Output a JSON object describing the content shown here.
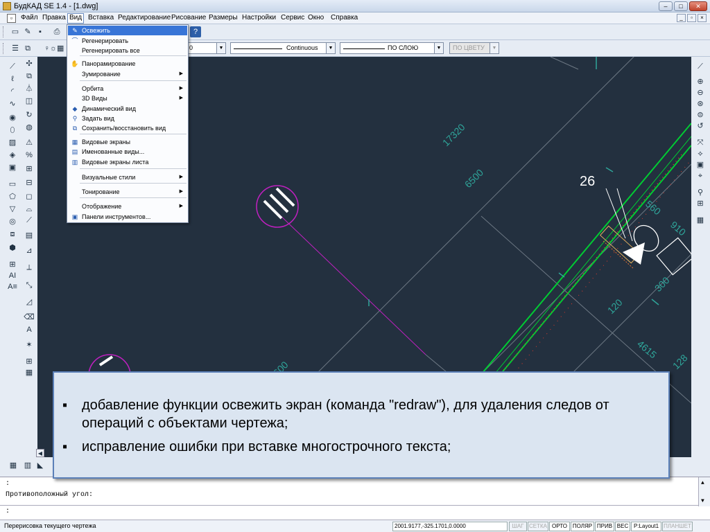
{
  "window": {
    "title": "БудКАД SE 1.4 - [1.dwg]"
  },
  "menubar": {
    "items": [
      "Файл",
      "Правка",
      "Вид",
      "Вставка",
      "Редактирование",
      "Рисование",
      "Размеры",
      "Настройки",
      "Сервис",
      "Окно",
      "Справка"
    ],
    "active": "Вид"
  },
  "toolbar2": {
    "linetype": "Continuous",
    "lineweight": "ПО СЛОЮ",
    "color": "ПО ЦВЕТУ",
    "layer_value": "0"
  },
  "view_menu": {
    "items": [
      {
        "label": "Освежить",
        "icon": "brush-icon",
        "selected": true
      },
      {
        "label": "Регенерировать",
        "icon": "regen-icon"
      },
      {
        "label": "Регенерировать все",
        "icon": ""
      },
      {
        "label": "Панорамирование",
        "icon": "pan-icon"
      },
      {
        "label": "Зумирование",
        "icon": "",
        "submenu": true
      },
      {
        "label": "Орбита",
        "icon": "",
        "submenu": true
      },
      {
        "label": "3D Виды",
        "icon": "",
        "submenu": true
      },
      {
        "label": "Динамический вид",
        "icon": "dynamic-view-icon"
      },
      {
        "label": "Задать вид",
        "icon": "set-view-icon"
      },
      {
        "label": "Сохранить/восстановить вид",
        "icon": "save-view-icon"
      },
      {
        "label": "Видовые экраны",
        "icon": "viewports-icon"
      },
      {
        "label": "Именованные виды...",
        "icon": "named-views-icon"
      },
      {
        "label": "Видовые экраны листа",
        "icon": "sheet-viewports-icon"
      },
      {
        "label": "Визуальные стили",
        "icon": "",
        "submenu": true
      },
      {
        "label": "Тонирование",
        "icon": "",
        "submenu": true
      },
      {
        "label": "Отображение",
        "icon": "",
        "submenu": true
      },
      {
        "label": "Панели инструментов...",
        "icon": "toolbars-icon"
      }
    ]
  },
  "drawing": {
    "dims": [
      "17320",
      "6500",
      "560",
      "910",
      "120",
      "4615",
      "300",
      "128",
      "600"
    ],
    "room_tag": "26"
  },
  "overlay": {
    "bullets": [
      "добавление функции освежить экран (команда \"redraw\"), для удаления следов от операций с объектами чертежа;",
      "исправление ошибки при вставке многострочного текста;"
    ]
  },
  "command": {
    "lines": [
      ":",
      "Противоположный угол:",
      ":"
    ]
  },
  "status": {
    "hint": "Перерисовка текущего чертежа",
    "coords": "2001.9177,-325.1701,0.0000",
    "toggles": [
      {
        "label": "ШАГ",
        "on": false
      },
      {
        "label": "СЕТКА",
        "on": false
      },
      {
        "label": "ОРТО",
        "on": true
      },
      {
        "label": "ПОЛЯР",
        "on": true
      },
      {
        "label": "ПРИВ",
        "on": true
      },
      {
        "label": "ВЕС",
        "on": true
      },
      {
        "label": "P:Layout1",
        "on": true
      },
      {
        "label": "ПЛАНШЕТ",
        "on": false
      }
    ]
  },
  "colors": {
    "canvas": "#23303f",
    "green": "#00cc33",
    "magenta": "#c020c0",
    "dim_text": "#2fa59a",
    "accent": "#3875d7"
  }
}
